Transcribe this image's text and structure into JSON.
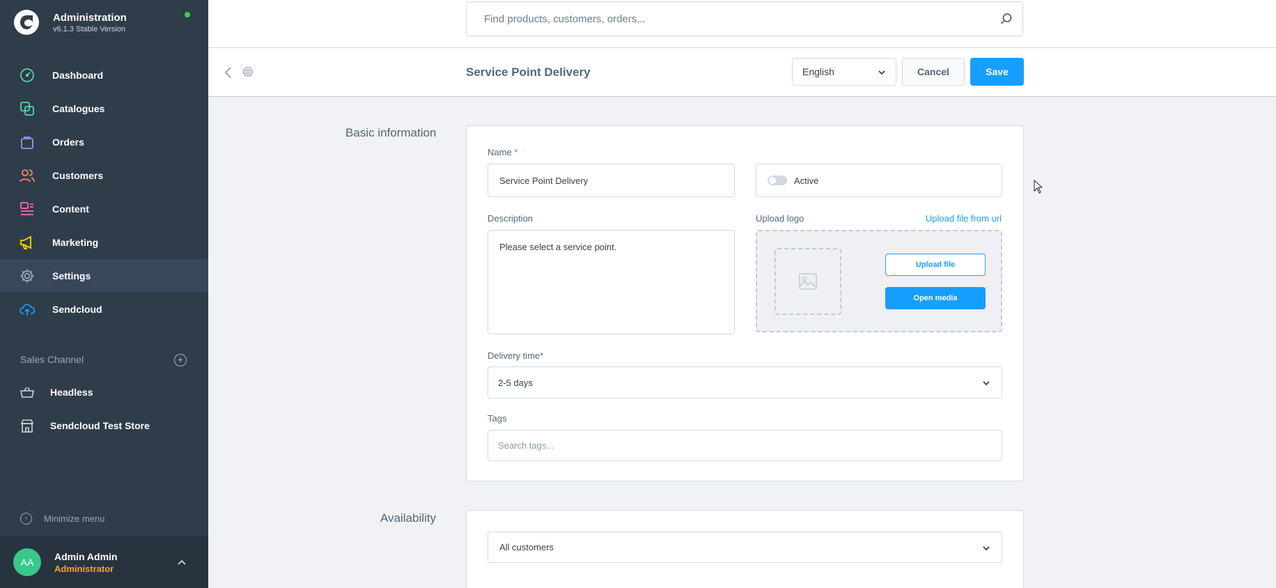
{
  "app": {
    "title": "Administration",
    "version": "v6.1.3 Stable Version",
    "status_color": "#37d046"
  },
  "sidebar": {
    "items": [
      {
        "label": "Dashboard",
        "icon": "gauge-icon",
        "color": "#57d9a3"
      },
      {
        "label": "Catalogues",
        "icon": "catalogue-icon",
        "color": "#57d9a3"
      },
      {
        "label": "Orders",
        "icon": "shopping-bag-icon",
        "color": "#a092f0"
      },
      {
        "label": "Customers",
        "icon": "users-icon",
        "color": "#f88962"
      },
      {
        "label": "Content",
        "icon": "content-icon",
        "color": "#ff68b4"
      },
      {
        "label": "Marketing",
        "icon": "megaphone-icon",
        "color": "#ffd700"
      },
      {
        "label": "Settings",
        "icon": "gear-icon",
        "color": "#9aa8b5"
      },
      {
        "label": "Sendcloud",
        "icon": "cloud-upload-icon",
        "color": "#189eff"
      }
    ],
    "active_item": "Settings",
    "sales_channel_label": "Sales Channel",
    "channels": [
      {
        "label": "Headless",
        "icon": "basket-icon"
      },
      {
        "label": "Sendcloud Test Store",
        "icon": "storefront-icon"
      }
    ],
    "minimize_label": "Minimize menu"
  },
  "user": {
    "initials": "AA",
    "name": "Admin Admin",
    "role": "Administrator"
  },
  "search": {
    "placeholder": "Find products, customers, orders..."
  },
  "header": {
    "title": "Service Point Delivery",
    "language": "English",
    "cancel_label": "Cancel",
    "save_label": "Save"
  },
  "basic_info": {
    "heading": "Basic information",
    "name_label": "Name",
    "name_required": "*",
    "name_value": "Service Point Delivery",
    "active_label": "Active",
    "active": false,
    "description_label": "Description",
    "description_value": "Please select a service point.",
    "upload_logo_label": "Upload logo",
    "upload_from_url": "Upload file from url",
    "upload_file_label": "Upload file",
    "open_media_label": "Open media",
    "delivery_time_label": "Delivery time*",
    "delivery_time_value": "2-5 days",
    "tags_label": "Tags",
    "tags_placeholder": "Search tags..."
  },
  "availability": {
    "heading": "Availability",
    "rule_value": "All customers"
  }
}
